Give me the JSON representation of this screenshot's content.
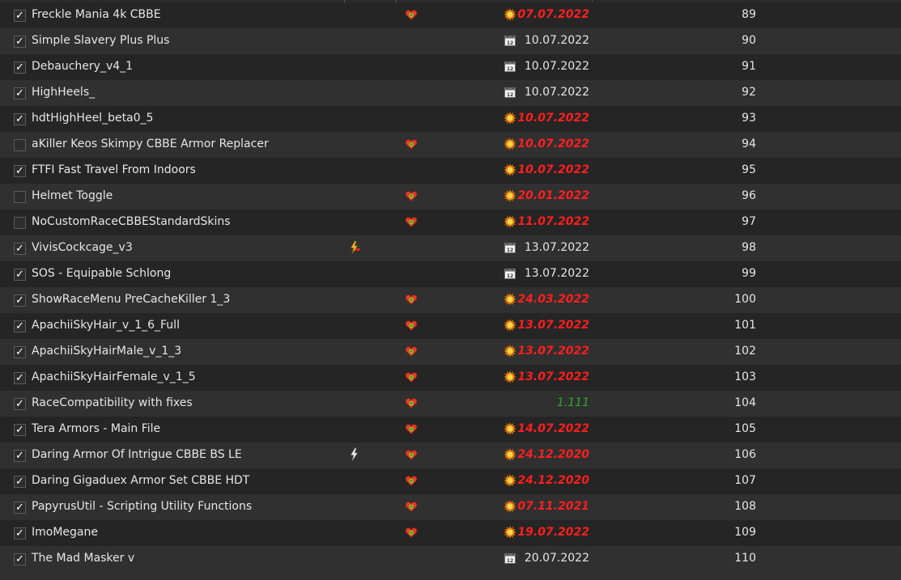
{
  "colors": {
    "row_odd": "#252525",
    "row_even": "#303030",
    "outdated_date": "#ff1e1e",
    "version_text": "#2fa82f"
  },
  "mod_list": [
    {
      "checked": true,
      "name": "Freckle Mania 4k CBBE",
      "flag": "",
      "category_icon": "heart-shield-icon",
      "status": "outdated",
      "date": "07.07.2022",
      "priority": "89"
    },
    {
      "checked": true,
      "name": "Simple Slavery Plus Plus",
      "flag": "",
      "category_icon": "",
      "status": "normal",
      "date": "10.07.2022",
      "priority": "90"
    },
    {
      "checked": true,
      "name": "Debauchery_v4_1",
      "flag": "",
      "category_icon": "",
      "status": "normal",
      "date": "10.07.2022",
      "priority": "91"
    },
    {
      "checked": true,
      "name": "HighHeels_",
      "flag": "",
      "category_icon": "",
      "status": "normal",
      "date": "10.07.2022",
      "priority": "92"
    },
    {
      "checked": true,
      "name": "hdtHighHeel_beta0_5",
      "flag": "",
      "category_icon": "",
      "status": "outdated",
      "date": "10.07.2022",
      "priority": "93"
    },
    {
      "checked": false,
      "name": "aKiller Keos Skimpy CBBE Armor Replacer",
      "flag": "",
      "category_icon": "heart-shield-icon",
      "status": "outdated",
      "date": "10.07.2022",
      "priority": "94"
    },
    {
      "checked": true,
      "name": "FTFI Fast Travel From Indoors",
      "flag": "",
      "category_icon": "",
      "status": "outdated",
      "date": "10.07.2022",
      "priority": "95"
    },
    {
      "checked": false,
      "name": "Helmet Toggle",
      "flag": "",
      "category_icon": "heart-shield-icon",
      "status": "outdated",
      "date": "20.01.2022",
      "priority": "96"
    },
    {
      "checked": false,
      "name": "NoCustomRaceCBBEStandardSkins",
      "flag": "",
      "category_icon": "heart-shield-icon",
      "status": "outdated",
      "date": "11.07.2022",
      "priority": "97"
    },
    {
      "checked": true,
      "name": "VivisCockcage_v3",
      "flag": "conflict-lightning-icon",
      "category_icon": "",
      "status": "normal",
      "date": "13.07.2022",
      "priority": "98"
    },
    {
      "checked": true,
      "name": "SOS - Equipable Schlong",
      "flag": "",
      "category_icon": "",
      "status": "normal",
      "date": "13.07.2022",
      "priority": "99"
    },
    {
      "checked": true,
      "name": "ShowRaceMenu PreCacheKiller 1_3",
      "flag": "",
      "category_icon": "heart-shield-icon",
      "status": "outdated",
      "date": "24.03.2022",
      "priority": "100"
    },
    {
      "checked": true,
      "name": "ApachiiSkyHair_v_1_6_Full",
      "flag": "",
      "category_icon": "heart-shield-icon",
      "status": "outdated",
      "date": "13.07.2022",
      "priority": "101"
    },
    {
      "checked": true,
      "name": "ApachiiSkyHairMale_v_1_3",
      "flag": "",
      "category_icon": "heart-shield-icon",
      "status": "outdated",
      "date": "13.07.2022",
      "priority": "102"
    },
    {
      "checked": true,
      "name": "ApachiiSkyHairFemale_v_1_5",
      "flag": "",
      "category_icon": "heart-shield-icon",
      "status": "outdated",
      "date": "13.07.2022",
      "priority": "103"
    },
    {
      "checked": true,
      "name": "RaceCompatibility with fixes",
      "flag": "",
      "category_icon": "heart-shield-icon",
      "status": "version",
      "date": "1.111",
      "priority": "104"
    },
    {
      "checked": true,
      "name": "Tera Armors - Main File",
      "flag": "",
      "category_icon": "heart-shield-icon",
      "status": "outdated",
      "date": "14.07.2022",
      "priority": "105"
    },
    {
      "checked": true,
      "name": "Daring Armor Of Intrigue CBBE BS LE",
      "flag": "overwritten-lightning-icon",
      "category_icon": "heart-shield-icon",
      "status": "outdated",
      "date": "24.12.2020",
      "priority": "106"
    },
    {
      "checked": true,
      "name": "Daring Gigaduex Armor Set CBBE HDT",
      "flag": "",
      "category_icon": "heart-shield-icon",
      "status": "outdated",
      "date": "24.12.2020",
      "priority": "107"
    },
    {
      "checked": true,
      "name": "PapyrusUtil - Scripting Utility Functions",
      "flag": "",
      "category_icon": "heart-shield-icon",
      "status": "outdated",
      "date": "07.11.2021",
      "priority": "108"
    },
    {
      "checked": true,
      "name": "ImoMegane",
      "flag": "",
      "category_icon": "heart-shield-icon",
      "status": "outdated",
      "date": "19.07.2022",
      "priority": "109"
    },
    {
      "checked": true,
      "name": "The Mad Masker v",
      "flag": "",
      "category_icon": "",
      "status": "normal",
      "date": "20.07.2022",
      "priority": "110"
    }
  ]
}
